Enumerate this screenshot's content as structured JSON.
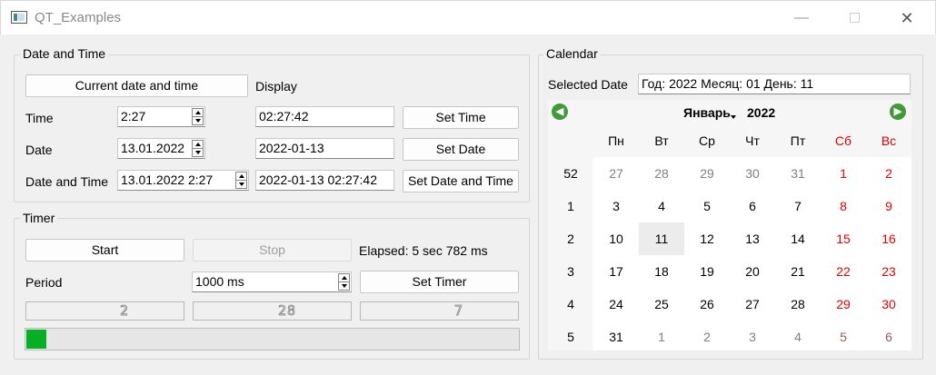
{
  "window": {
    "title": "QT_Examples",
    "minimize": "—",
    "close": "✕"
  },
  "datetime": {
    "group_title": "Date and Time",
    "current_button": "Current date and time",
    "display_label": "Display",
    "time_label": "Time",
    "time_value": "2:27",
    "time_display": "02:27:42",
    "set_time_button": "Set Time",
    "date_label": "Date",
    "date_value": "13.01.2022",
    "date_display": "2022-01-13",
    "set_date_button": "Set Date",
    "datetime_label": "Date and Time",
    "datetime_value": "13.01.2022 2:27",
    "datetime_display": "2022-01-13 02:27:42",
    "set_datetime_button": "Set Date and Time"
  },
  "timer": {
    "group_title": "Timer",
    "start_button": "Start",
    "stop_button": "Stop",
    "elapsed": "Elapsed: 5 sec 782 ms",
    "period_label": "Period",
    "period_value": "1000 ms",
    "set_timer_button": "Set Timer",
    "lcd_values": [
      "2",
      "28",
      "7"
    ],
    "progress_fraction": 0.04
  },
  "calendar": {
    "group_title": "Calendar",
    "selected_label": "Selected Date",
    "selected_value": "Год: 2022 Месяц: 01 День: 11",
    "month": "Январь",
    "year": "2022",
    "prev_icon": "◀",
    "next_icon": "▶",
    "days_of_week": [
      "Пн",
      "Вт",
      "Ср",
      "Чт",
      "Пт",
      "Сб",
      "Вс"
    ],
    "weeks": [
      {
        "num": "52",
        "days": [
          "27",
          "28",
          "29",
          "30",
          "31",
          "1",
          "2"
        ]
      },
      {
        "num": "1",
        "days": [
          "3",
          "4",
          "5",
          "6",
          "7",
          "8",
          "9"
        ]
      },
      {
        "num": "2",
        "days": [
          "10",
          "11",
          "12",
          "13",
          "14",
          "15",
          "16"
        ]
      },
      {
        "num": "3",
        "days": [
          "17",
          "18",
          "19",
          "20",
          "21",
          "22",
          "23"
        ]
      },
      {
        "num": "4",
        "days": [
          "24",
          "25",
          "26",
          "27",
          "28",
          "29",
          "30"
        ]
      },
      {
        "num": "5",
        "days": [
          "31",
          "1",
          "2",
          "3",
          "4",
          "5",
          "6"
        ]
      }
    ],
    "selected_day": "11",
    "colors": {
      "weekend": "#e00000",
      "selected_bg": "#ececec",
      "nav": "#3f9a37",
      "progress": "#06b025"
    }
  }
}
